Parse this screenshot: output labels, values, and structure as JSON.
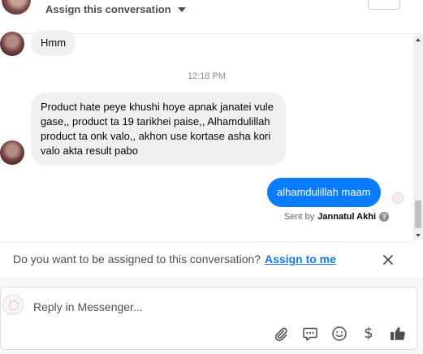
{
  "header": {
    "assign_label": "Assign this conversation"
  },
  "messages": {
    "msg1": "Hmm",
    "timestamp": "12:18 PM",
    "msg2": "Product hate peye khushi hoye apnak janatei vule gase,, product ta 19 tarikhei paise,, Alhamdulillah product ta onk valo,,  akhon use kortase asha kori valo akta result pabo",
    "msg3": "alhamdulillah maam",
    "sent_by_prefix": "Sent by",
    "sent_by_name": "Jannatul Akhi",
    "help_glyph": "?"
  },
  "assign_bar": {
    "question": "Do you want to be assigned to this conversation?",
    "action": "Assign to me"
  },
  "composer": {
    "placeholder": "Reply in Messenger...",
    "dollar_glyph": "$"
  },
  "colors": {
    "outgoing_bubble": "#0a7cff",
    "incoming_bubble": "#f0f0f0",
    "link_blue": "#1877f2"
  },
  "icons": [
    "caret-down-icon",
    "close-icon",
    "attachment-icon",
    "saved-replies-icon",
    "emoji-icon",
    "payment-icon",
    "like-icon",
    "help-icon"
  ]
}
